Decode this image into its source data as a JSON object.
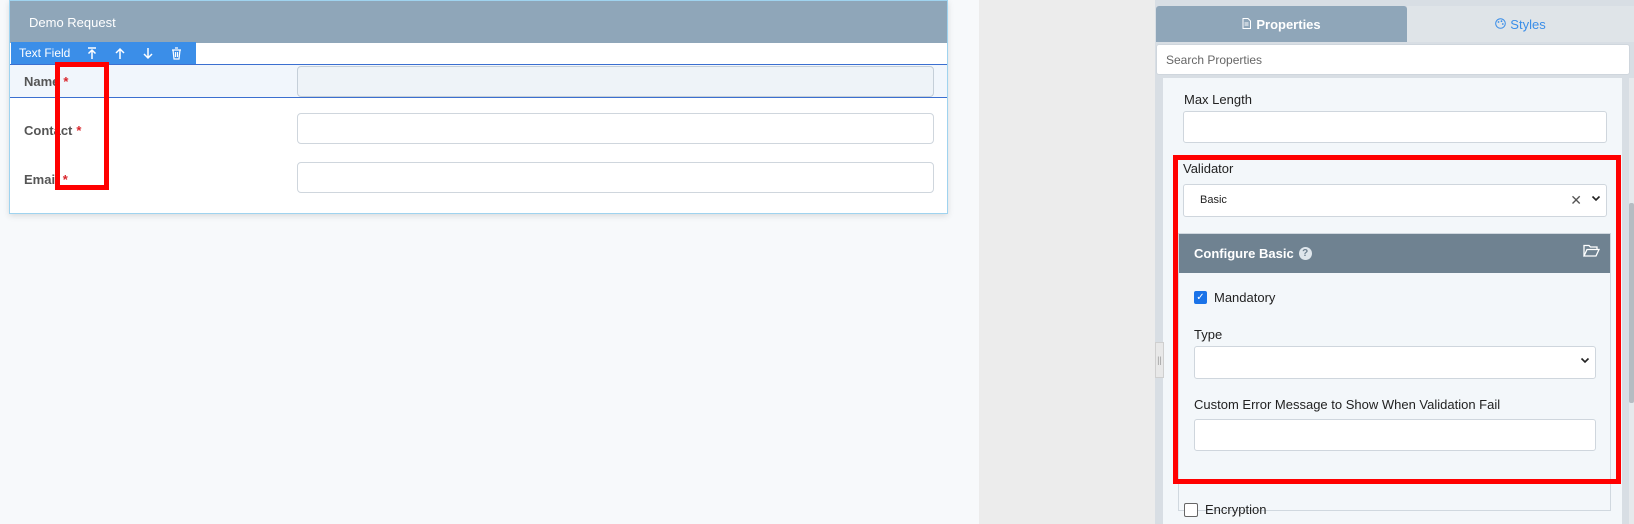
{
  "form": {
    "title": "Demo Request",
    "toolbar": {
      "label": "Text Field",
      "icons": [
        "move-top-icon",
        "arrow-up-icon",
        "arrow-down-icon",
        "trash-icon"
      ]
    },
    "fields": [
      {
        "label": "Name",
        "required_mark": "*",
        "value": ""
      },
      {
        "label": "Contact",
        "required_mark": "*",
        "value": ""
      },
      {
        "label": "Email",
        "required_mark": "*",
        "value": ""
      }
    ]
  },
  "panel": {
    "tabs": {
      "properties": "Properties",
      "styles": "Styles"
    },
    "search": {
      "placeholder": "Search Properties",
      "value": ""
    },
    "max_length": {
      "label": "Max Length",
      "value": ""
    },
    "validator": {
      "label": "Validator",
      "value": "Basic",
      "clear_glyph": "✕"
    },
    "configure": {
      "title": "Configure Basic",
      "help_glyph": "?",
      "mandatory": {
        "label": "Mandatory",
        "checked": true
      },
      "type": {
        "label": "Type",
        "value": ""
      },
      "error_message": {
        "label": "Custom Error Message to Show When Validation Fail",
        "value": ""
      }
    },
    "encryption": {
      "label": "Encryption",
      "checked": false
    }
  },
  "colors": {
    "header": "#8fa6b9",
    "toolbar": "#3b8ee8",
    "highlight": "#ff0000",
    "configure_header": "#6f8291",
    "required": "#d9252b"
  }
}
